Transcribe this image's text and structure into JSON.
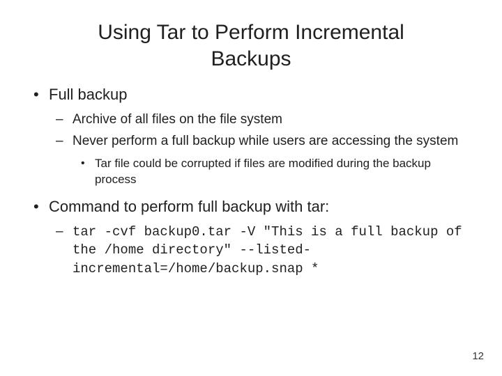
{
  "title": "Using Tar to Perform Incremental Backups",
  "bullets": [
    {
      "text": "Full backup",
      "children": [
        {
          "text": "Archive of all files on the file system"
        },
        {
          "text": "Never perform a full backup while users are accessing the system",
          "children": [
            {
              "text": "Tar file could be corrupted if files are modified during the backup process"
            }
          ]
        }
      ]
    },
    {
      "text": "Command to perform full backup with tar:",
      "children": [
        {
          "mono": true,
          "text": "tar -cvf backup0.tar -V \"This is a full backup of the /home directory\" --listed-incremental=/home/backup.snap *"
        }
      ]
    }
  ],
  "page_number": "12"
}
